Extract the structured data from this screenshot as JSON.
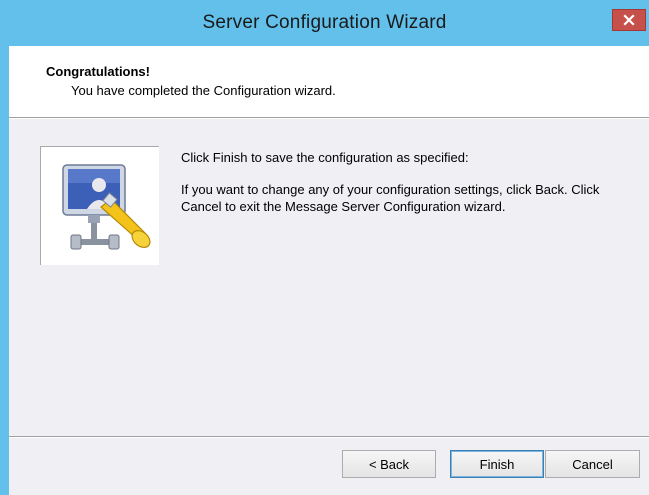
{
  "window": {
    "title": "Server Configuration Wizard",
    "close_label": "x"
  },
  "header": {
    "title": "Congratulations!",
    "subtitle": "You have completed the Configuration wizard."
  },
  "body": {
    "line1": "Click Finish to save the configuration as specified:",
    "line2": "If you want to change any of your configuration settings, click Back. Click Cancel to exit the Message Server Configuration wizard."
  },
  "buttons": {
    "back": "< Back",
    "finish": "Finish",
    "cancel": "Cancel"
  },
  "icons": {
    "wizard_image": "monitor-with-network-plug-icon",
    "close": "close-icon"
  },
  "colors": {
    "titlebar": "#62c0ea",
    "close_button": "#c7504a",
    "dialog_bg": "#f0eff3",
    "header_bg": "#ffffff"
  }
}
